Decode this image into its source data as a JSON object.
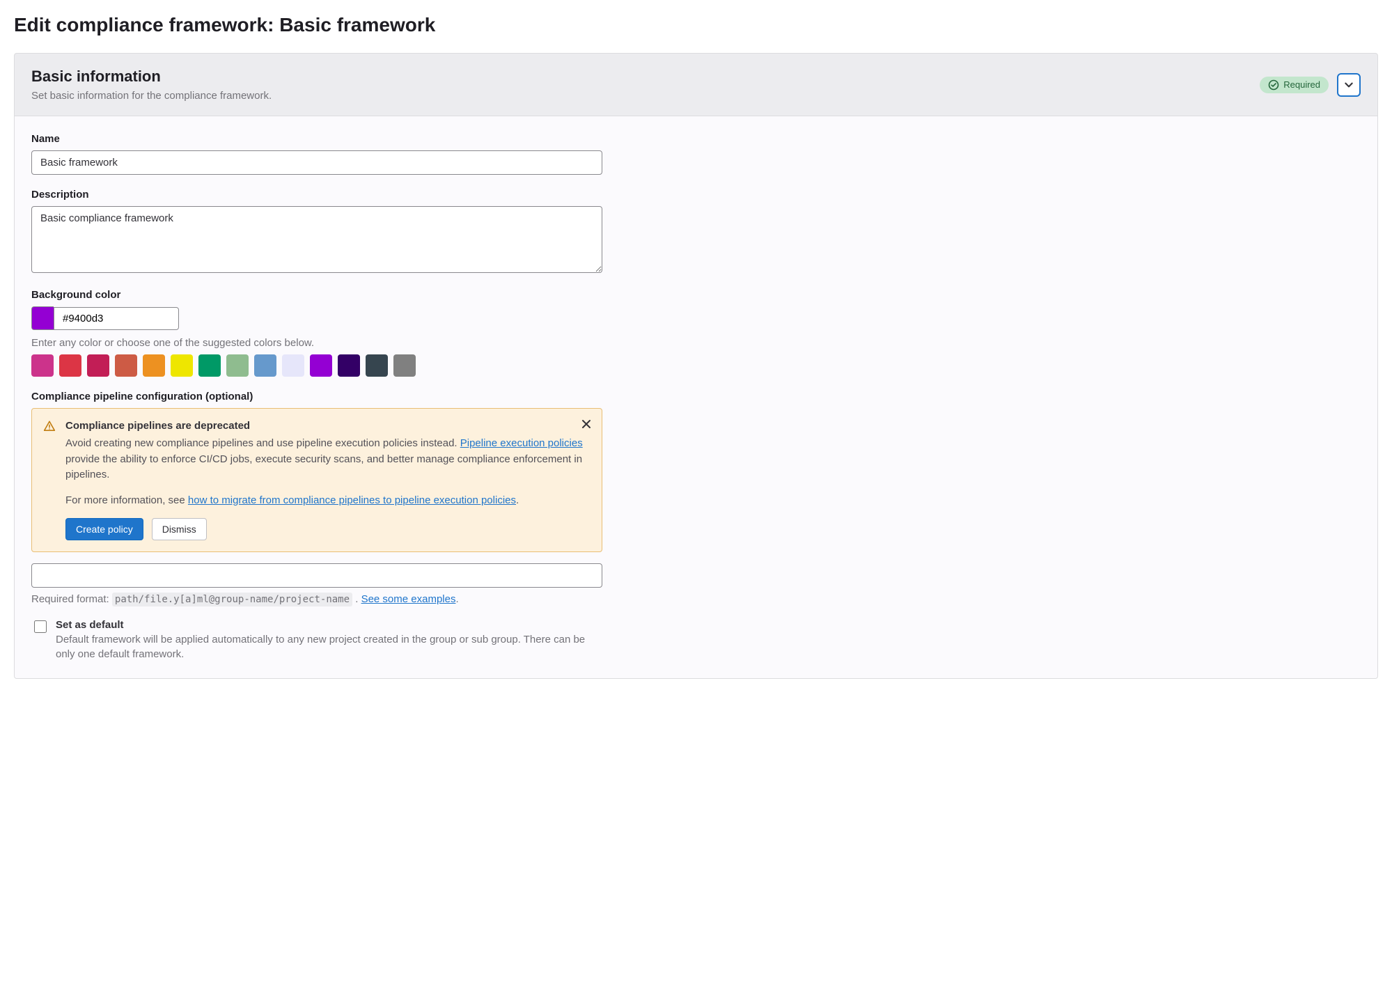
{
  "page_title": "Edit compliance framework: Basic framework",
  "section": {
    "title": "Basic information",
    "description": "Set basic information for the compliance framework.",
    "required_badge": "Required"
  },
  "form": {
    "name_label": "Name",
    "name_value": "Basic framework",
    "description_label": "Description",
    "description_value": "Basic compliance framework",
    "bgcolor_label": "Background color",
    "bgcolor_value": "#9400d3",
    "bgcolor_helper": "Enter any color or choose one of the suggested colors below.",
    "swatches": [
      "#cc338b",
      "#dc3545",
      "#c21e56",
      "#cd5b45",
      "#ed9121",
      "#eee600",
      "#009966",
      "#8fbc8f",
      "#6699cc",
      "#e6e6fa",
      "#9400d3",
      "#330066",
      "#36454f",
      "#808080"
    ],
    "pipeline_label": "Compliance pipeline configuration (optional)",
    "pipeline_value": "",
    "format_prefix": "Required format: ",
    "format_code": "path/file.y[a]ml@group-name/project-name",
    "format_link": "See some examples",
    "default_label": "Set as default",
    "default_desc": "Default framework will be applied automatically to any new project created in the group or sub group. There can be only one default framework."
  },
  "alert": {
    "title": "Compliance pipelines are deprecated",
    "body1_a": "Avoid creating new compliance pipelines and use pipeline execution policies instead. ",
    "body1_link": "Pipeline execution policies",
    "body1_b": " provide the ability to enforce CI/CD jobs, execute security scans, and better manage compliance enforcement in pipelines.",
    "body2_a": "For more information, see ",
    "body2_link": "how to migrate from compliance pipelines to pipeline execution policies",
    "body2_b": ".",
    "create_btn": "Create policy",
    "dismiss_btn": "Dismiss"
  }
}
